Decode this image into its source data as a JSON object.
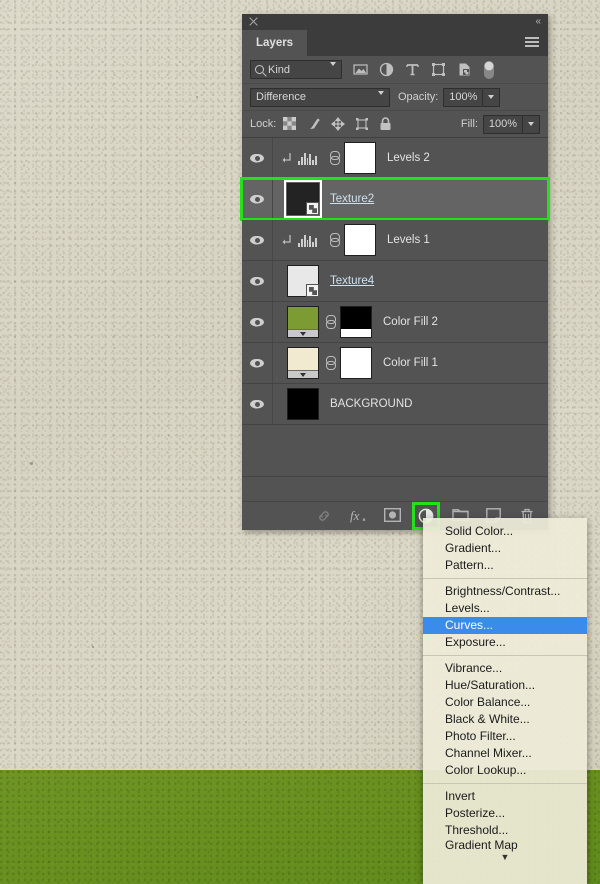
{
  "panel": {
    "title": "Layers",
    "close_icon": "close-icon",
    "collapse_icon": "collapse-panel-icon",
    "menu_icon": "panel-menu-icon",
    "filter": {
      "kind_label": "Kind",
      "search_icon": "search-icon",
      "icons": [
        "pixel-layer-filter-icon",
        "adjustment-layer-filter-icon",
        "type-layer-filter-icon",
        "shape-layer-filter-icon",
        "smart-object-filter-icon"
      ],
      "toggle_icon": "filter-toggle-switch"
    },
    "blend": {
      "mode": "Difference",
      "opacity_label": "Opacity:",
      "opacity_value": "100%"
    },
    "lock": {
      "label": "Lock:",
      "icons": [
        "lock-transparent-pixels-icon",
        "lock-image-pixels-icon",
        "lock-position-icon",
        "lock-artboard-icon",
        "lock-all-icon"
      ],
      "fill_label": "Fill:",
      "fill_value": "100%"
    },
    "layers": [
      {
        "name": "Levels 2",
        "type": "adjustment",
        "clipped": true,
        "visible": true,
        "selected": false,
        "linked": true,
        "thumb_color": "#ffffff",
        "mask_color": "#ffffff",
        "link_style": false
      },
      {
        "name": "Texture2",
        "type": "smart-object",
        "clipped": false,
        "visible": true,
        "selected": true,
        "linked": false,
        "thumb_color": "#232323",
        "mask_color": "",
        "link_style": true
      },
      {
        "name": "Levels 1",
        "type": "adjustment",
        "clipped": true,
        "visible": true,
        "selected": false,
        "linked": true,
        "thumb_color": "#ffffff",
        "mask_color": "#ffffff",
        "link_style": false
      },
      {
        "name": "Texture4",
        "type": "smart-object",
        "clipped": false,
        "visible": true,
        "selected": false,
        "linked": false,
        "thumb_color": "#e8e8e8",
        "mask_color": "",
        "link_style": true
      },
      {
        "name": "Color Fill 2",
        "type": "fill",
        "clipped": false,
        "visible": true,
        "selected": false,
        "linked": true,
        "thumb_color": "#7d9b33",
        "mask_color": "#000000",
        "link_style": false
      },
      {
        "name": "Color Fill 1",
        "type": "fill",
        "clipped": false,
        "visible": true,
        "selected": false,
        "linked": true,
        "thumb_color": "#f2ead0",
        "mask_color": "#ffffff",
        "link_style": false
      },
      {
        "name": "BACKGROUND",
        "type": "pixel",
        "clipped": false,
        "visible": true,
        "selected": false,
        "linked": false,
        "thumb_color": "#000000",
        "mask_color": "",
        "link_style": false
      }
    ],
    "bottom_icons": [
      {
        "name": "link-layers-icon",
        "label": "link"
      },
      {
        "name": "layer-style-fx-icon",
        "label": "fx"
      },
      {
        "name": "add-layer-mask-icon",
        "label": "mask"
      },
      {
        "name": "new-adjustment-layer-icon",
        "label": "adjustment",
        "highlighted": true
      },
      {
        "name": "new-group-icon",
        "label": "group"
      },
      {
        "name": "new-layer-icon",
        "label": "new"
      },
      {
        "name": "delete-layer-icon",
        "label": "delete"
      }
    ]
  },
  "context_menu": {
    "highlighted": "Curves...",
    "scroll_icon": "scroll-down-arrow",
    "groups": [
      [
        "Solid Color...",
        "Gradient...",
        "Pattern..."
      ],
      [
        "Brightness/Contrast...",
        "Levels...",
        "Curves...",
        "Exposure..."
      ],
      [
        "Vibrance...",
        "Hue/Saturation...",
        "Color Balance...",
        "Black & White...",
        "Photo Filter...",
        "Channel Mixer...",
        "Color Lookup..."
      ],
      [
        "Invert",
        "Posterize...",
        "Threshold...",
        "Gradient Map"
      ]
    ]
  },
  "annotations": {
    "highlight_color": "#25e01a",
    "selected_layer_box": "Texture2",
    "highlighted_tool": "new-adjustment-layer-icon"
  },
  "background": {
    "top_color": "#d9d5c4",
    "bottom_color": "#6a9020"
  }
}
